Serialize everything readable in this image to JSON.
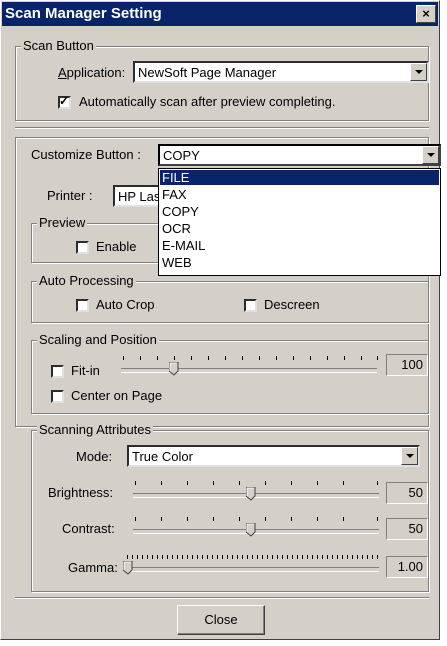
{
  "window": {
    "title": "Scan Manager Setting",
    "close_glyph": "×"
  },
  "scan_button": {
    "legend": "Scan Button",
    "application_label": "Application:",
    "application_value": "NewSoft Page Manager",
    "auto_scan_label": "Automatically scan after preview completing.",
    "auto_scan_checked": true
  },
  "customize": {
    "label": "Customize Button :",
    "value": "COPY",
    "options": [
      "FILE",
      "FAX",
      "COPY",
      "OCR",
      "E-MAIL",
      "WEB"
    ],
    "highlighted": "FILE"
  },
  "printer": {
    "label": "Printer :",
    "value": "HP Las"
  },
  "preview": {
    "legend": "Preview",
    "enable_label": "Enable",
    "enable_checked": false
  },
  "auto_processing": {
    "legend": "Auto Processing",
    "auto_crop_label": "Auto Crop",
    "auto_crop_checked": false,
    "descreen_label": "Descreen",
    "descreen_checked": false
  },
  "scaling": {
    "legend": "Scaling and Position",
    "fit_in_label": "Fit-in",
    "fit_in_checked": false,
    "scale_value": "100",
    "center_label": "Center on Page",
    "center_checked": false
  },
  "attributes": {
    "legend": "Scanning Attributes",
    "mode_label": "Mode:",
    "mode_value": "True Color",
    "brightness_label": "Brightness:",
    "brightness_value": "50",
    "contrast_label": "Contrast:",
    "contrast_value": "50",
    "gamma_label": "Gamma:",
    "gamma_value": "1.00"
  },
  "buttons": {
    "close_label": "Close"
  }
}
